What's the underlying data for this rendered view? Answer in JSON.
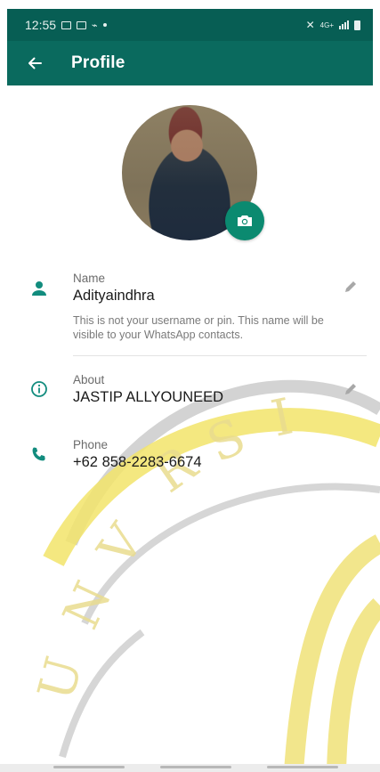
{
  "status_bar": {
    "time": "12:55",
    "network": "4G+"
  },
  "header": {
    "title": "Profile"
  },
  "profile": {
    "name_label": "Name",
    "name_value": "Adityaindhra",
    "name_hint": "This is not your username or pin. This name will be visible to your WhatsApp contacts.",
    "about_label": "About",
    "about_value": "JASTIP ALLYOUNEED",
    "phone_label": "Phone",
    "phone_value": "+62 858-2283-6674"
  },
  "colors": {
    "app_bar": "#0a6a5e",
    "status_bar": "#075e54",
    "accent": "#0b8a70",
    "icon": "#128c7e"
  },
  "icons": [
    "back-arrow-icon",
    "camera-icon",
    "person-icon",
    "pencil-icon",
    "info-icon",
    "phone-icon"
  ]
}
